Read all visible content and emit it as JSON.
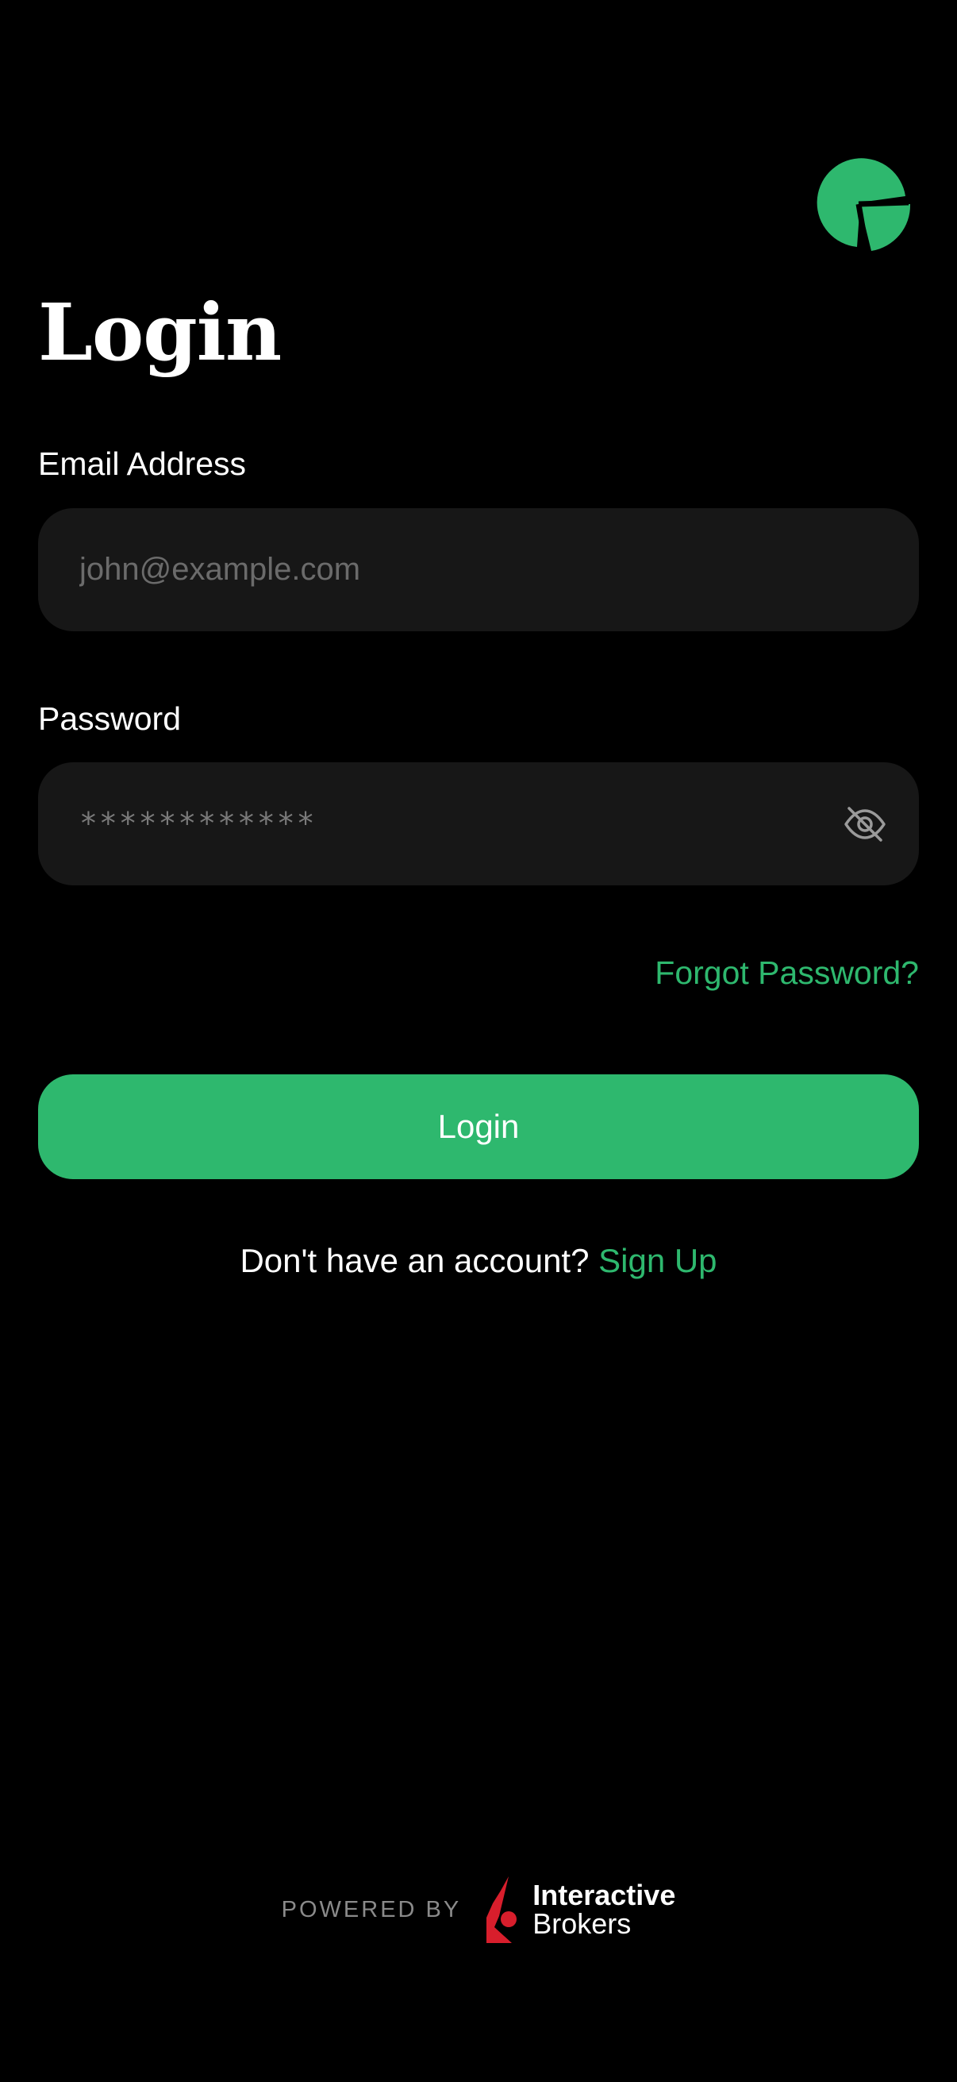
{
  "app": {
    "logo_icon": "pie-chart-logo-icon",
    "accent_color": "#2eb86e",
    "background_color": "#000000",
    "input_background": "#171717"
  },
  "page": {
    "title": "Login"
  },
  "email": {
    "label": "Email Address",
    "placeholder": "john@example.com",
    "value": ""
  },
  "password": {
    "label": "Password",
    "masked_value": "************",
    "toggle_icon": "eye-off-icon"
  },
  "forgot_password": {
    "label": "Forgot Password?"
  },
  "login_button": {
    "label": "Login"
  },
  "signup": {
    "prompt": "Don't have an account?",
    "link_label": "Sign Up"
  },
  "footer": {
    "powered_by": "POWERED BY",
    "partner_line1": "Interactive",
    "partner_line2": "Brokers",
    "partner_icon": "interactive-brokers-logo-icon"
  }
}
